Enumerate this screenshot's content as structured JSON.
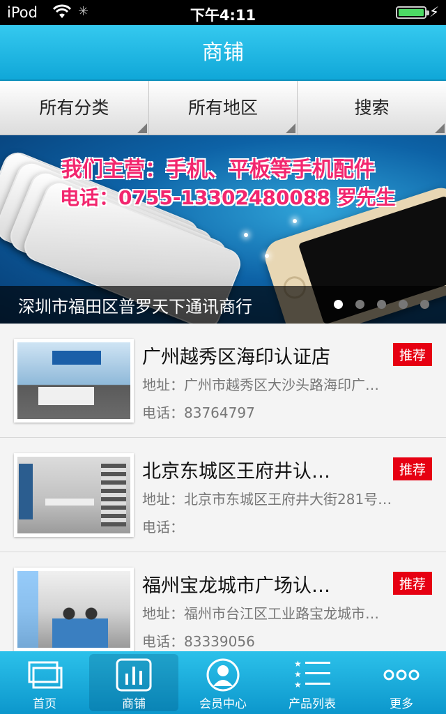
{
  "status_bar": {
    "carrier": "iPod",
    "time": "下午4:11"
  },
  "nav": {
    "title": "商铺"
  },
  "filters": [
    {
      "label": "所有分类"
    },
    {
      "label": "所有地区"
    },
    {
      "label": "搜索"
    }
  ],
  "banner": {
    "headline": "我们主营：手机、平板等手机配件",
    "contact": "电话：0755-13302480088 罗先生",
    "caption": "深圳市福田区普罗天下通讯商行",
    "slide_count": 5,
    "active_slide": 1
  },
  "shops": [
    {
      "name": "广州越秀区海印认证店",
      "badge": "推荐",
      "address": "地址：广州市越秀区大沙头路海印广…",
      "phone": "电话：83764797"
    },
    {
      "name": "北京东城区王府井认…",
      "badge": "推荐",
      "address": "地址：北京市东城区王府井大街281号…",
      "phone": "电话："
    },
    {
      "name": "福州宝龙城市广场认…",
      "badge": "推荐",
      "address": "地址：福州市台江区工业路宝龙城市…",
      "phone": "电话：83339056"
    }
  ],
  "tabs": [
    {
      "label": "首页",
      "icon": "home-windows-icon"
    },
    {
      "label": "商铺",
      "icon": "bar-chart-icon"
    },
    {
      "label": "会员中心",
      "icon": "user-avatar-icon"
    },
    {
      "label": "产品列表",
      "icon": "star-list-icon"
    },
    {
      "label": "更多",
      "icon": "more-dots-icon"
    }
  ],
  "active_tab": 1
}
